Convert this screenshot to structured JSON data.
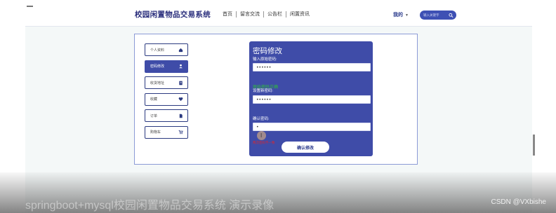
{
  "header": {
    "site_title": "校园闲置物品交易系统",
    "nav": [
      "首页",
      "留言交流",
      "公告栏",
      "闲置资讯"
    ],
    "mine_label": "我的",
    "search_placeholder": "输入关键字"
  },
  "sidebar": {
    "items": [
      {
        "label": "个人资料",
        "icon": "home-icon"
      },
      {
        "label": "密码修改",
        "icon": "user-icon",
        "active": true
      },
      {
        "label": "收货地址",
        "icon": "address-book-icon"
      },
      {
        "label": "收藏",
        "icon": "heart-icon"
      },
      {
        "label": "订单",
        "icon": "file-icon"
      },
      {
        "label": "购物车",
        "icon": "cart-icon"
      }
    ]
  },
  "form": {
    "title": "密码修改",
    "old_label": "输入原始密码:",
    "old_value": "••••••",
    "old_status": "原始密码正确",
    "new_label": "设置新密码:",
    "new_value": "••••••",
    "confirm_label": "确认密码:",
    "confirm_value": "•",
    "confirm_error": "两次密码不一致",
    "submit_label": "确认修改"
  },
  "video_caption": "springboot+mysql校园闲置物品交易系统 演示录像",
  "watermark": "CSDN @VXbishe",
  "colors": {
    "brand": "#3f4ca8",
    "success": "#2fbf3a",
    "error": "#e0262a"
  }
}
